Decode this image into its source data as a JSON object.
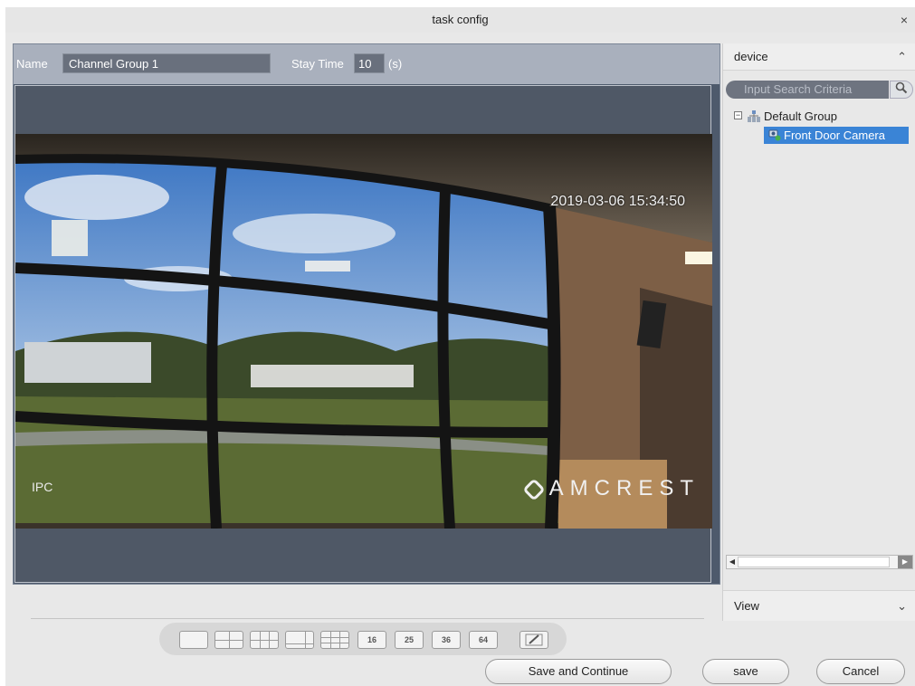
{
  "dialog": {
    "title": "task config",
    "close_glyph": "×"
  },
  "form": {
    "name_label": "Name",
    "name_value": "Channel Group 1",
    "stay_label": "Stay Time",
    "stay_value": "10",
    "stay_unit": "(s)"
  },
  "video": {
    "timestamp": "2019-03-06 15:34:50",
    "channel_label": "IPC",
    "brand": "AMCREST"
  },
  "sidebar": {
    "device_header": "device",
    "search_placeholder": "Input Search Criteria",
    "tree": {
      "group_label": "Default Group",
      "camera_label": "Front Door Camera"
    },
    "view_header": "View"
  },
  "layouts": {
    "labels": [
      "16",
      "25",
      "36",
      "64"
    ]
  },
  "buttons": {
    "save_continue": "Save and Continue",
    "save": "save",
    "cancel": "Cancel"
  },
  "colors": {
    "selection": "#3a84d6",
    "panel": "#4e5a6c"
  }
}
